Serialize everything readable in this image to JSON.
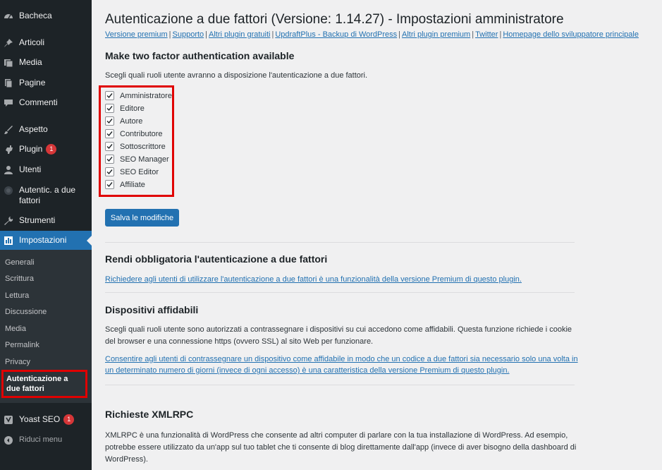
{
  "sidebar": {
    "items": [
      {
        "label": "Bacheca",
        "icon": "dashboard-icon"
      },
      {
        "label": "Articoli",
        "icon": "pin-icon"
      },
      {
        "label": "Media",
        "icon": "media-icon"
      },
      {
        "label": "Pagine",
        "icon": "pages-icon"
      },
      {
        "label": "Commenti",
        "icon": "comments-icon"
      },
      {
        "label": "Aspetto",
        "icon": "appearance-icon"
      },
      {
        "label": "Plugin",
        "icon": "plugin-icon",
        "badge": "1"
      },
      {
        "label": "Utenti",
        "icon": "users-icon"
      },
      {
        "label": "Autentic. a due fattori",
        "icon": "two-factor-icon"
      },
      {
        "label": "Strumenti",
        "icon": "tools-icon"
      },
      {
        "label": "Impostazioni",
        "icon": "settings-icon"
      }
    ],
    "submenu": [
      "Generali",
      "Scrittura",
      "Lettura",
      "Discussione",
      "Media",
      "Permalink",
      "Privacy",
      "Autenticazione a due fattori"
    ],
    "yoast": {
      "label": "Yoast SEO",
      "badge": "1",
      "icon": "yoast-icon"
    },
    "collapse": {
      "label": "Riduci menu",
      "icon": "collapse-icon"
    }
  },
  "header": {
    "title": "Autenticazione a due fattori (Versione: 1.14.27) - Impostazioni amministratore",
    "links": [
      "Versione premium",
      "Supporto",
      "Altri plugin gratuiti",
      "UpdraftPlus - Backup di WordPress",
      "Altri plugin premium",
      "Twitter",
      "Homepage dello sviluppatore principale"
    ]
  },
  "section1": {
    "heading": "Make two factor authentication available",
    "description": "Scegli quali ruoli utente avranno a disposizione l'autenticazione a due fattori.",
    "roles": [
      "Amministratore",
      "Editore",
      "Autore",
      "Contributore",
      "Sottoscrittore",
      "SEO Manager",
      "SEO Editor",
      "Affiliate"
    ],
    "save_label": "Salva le modifiche"
  },
  "section2": {
    "heading": "Rendi obbligatoria l'autenticazione a due fattori",
    "link": "Richiedere agli utenti di utilizzare l'autenticazione a due fattori è una funzionalità della versione Premium di questo plugin."
  },
  "section3": {
    "heading": "Dispositivi affidabili",
    "desc_line1": "Scegli quali ruoli utente sono autorizzati a contrassegnare i dispositivi su cui accedono come affidabili. Questa funzione richiede i cookie",
    "desc_line2": "del browser e una connessione https (ovvero SSL) al sito Web per funzionare.",
    "link_line1": "Consentire agli utenti di contrassegnare un dispositivo come affidabile in modo che un codice a due fattori sia necessario solo una volta in",
    "link_line2": "un determinato numero di giorni (invece di ogni accesso) è una caratteristica della versione Premium di questo plugin."
  },
  "section4": {
    "heading": "Richieste XMLRPC",
    "line1": "XMLRPC è una funzionalità di WordPress che consente ad altri computer di parlare con la tua installazione di WordPress. Ad esempio,",
    "line2": "potrebbe essere utilizzato da un'app sul tuo tablet che ti consente di blog direttamente dall'app (invece di aver bisogno della dashboard di",
    "line3": "WordPress)."
  },
  "colors": {
    "sidebar": "#1d2327",
    "accent": "#2271b1",
    "highlight": "#e00000",
    "badge": "#d63638"
  }
}
